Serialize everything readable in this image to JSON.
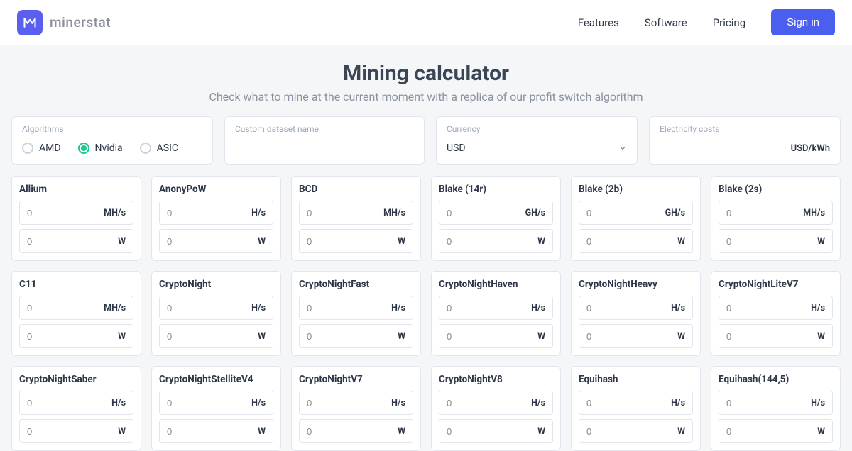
{
  "brand": "minerstat",
  "nav": {
    "features": "Features",
    "software": "Software",
    "pricing": "Pricing"
  },
  "signin": "Sign in",
  "hero": {
    "title": "Mining calculator",
    "subtitle": "Check what to mine at the current moment with a replica of our profit switch algorithm"
  },
  "filters": {
    "algorithms_label": "Algorithms",
    "options": {
      "amd": "AMD",
      "nvidia": "Nvidia",
      "asic": "ASIC"
    },
    "selected": "nvidia",
    "custom_label": "Custom dataset name",
    "custom_value": "",
    "currency_label": "Currency",
    "currency_value": "USD",
    "electricity_label": "Electricity costs",
    "electricity_unit": "USD/kWh"
  },
  "algos": [
    {
      "name": "Allium",
      "hash_value": "0",
      "hash_unit": "MH/s",
      "power_value": "0",
      "power_unit": "W"
    },
    {
      "name": "AnonyPoW",
      "hash_value": "0",
      "hash_unit": "H/s",
      "power_value": "0",
      "power_unit": "W"
    },
    {
      "name": "BCD",
      "hash_value": "0",
      "hash_unit": "MH/s",
      "power_value": "0",
      "power_unit": "W"
    },
    {
      "name": "Blake (14r)",
      "hash_value": "0",
      "hash_unit": "GH/s",
      "power_value": "0",
      "power_unit": "W"
    },
    {
      "name": "Blake (2b)",
      "hash_value": "0",
      "hash_unit": "GH/s",
      "power_value": "0",
      "power_unit": "W"
    },
    {
      "name": "Blake (2s)",
      "hash_value": "0",
      "hash_unit": "MH/s",
      "power_value": "0",
      "power_unit": "W"
    },
    {
      "name": "C11",
      "hash_value": "0",
      "hash_unit": "MH/s",
      "power_value": "0",
      "power_unit": "W"
    },
    {
      "name": "CryptoNight",
      "hash_value": "0",
      "hash_unit": "H/s",
      "power_value": "0",
      "power_unit": "W"
    },
    {
      "name": "CryptoNightFast",
      "hash_value": "0",
      "hash_unit": "H/s",
      "power_value": "0",
      "power_unit": "W"
    },
    {
      "name": "CryptoNightHaven",
      "hash_value": "0",
      "hash_unit": "H/s",
      "power_value": "0",
      "power_unit": "W"
    },
    {
      "name": "CryptoNightHeavy",
      "hash_value": "0",
      "hash_unit": "H/s",
      "power_value": "0",
      "power_unit": "W"
    },
    {
      "name": "CryptoNightLiteV7",
      "hash_value": "0",
      "hash_unit": "H/s",
      "power_value": "0",
      "power_unit": "W"
    },
    {
      "name": "CryptoNightSaber",
      "hash_value": "0",
      "hash_unit": "H/s",
      "power_value": "0",
      "power_unit": "W"
    },
    {
      "name": "CryptoNightStelliteV4",
      "hash_value": "0",
      "hash_unit": "H/s",
      "power_value": "0",
      "power_unit": "W"
    },
    {
      "name": "CryptoNightV7",
      "hash_value": "0",
      "hash_unit": "H/s",
      "power_value": "0",
      "power_unit": "W"
    },
    {
      "name": "CryptoNightV8",
      "hash_value": "0",
      "hash_unit": "H/s",
      "power_value": "0",
      "power_unit": "W"
    },
    {
      "name": "Equihash",
      "hash_value": "0",
      "hash_unit": "H/s",
      "power_value": "0",
      "power_unit": "W"
    },
    {
      "name": "Equihash(144,5)",
      "hash_value": "0",
      "hash_unit": "H/s",
      "power_value": "0",
      "power_unit": "W"
    }
  ]
}
